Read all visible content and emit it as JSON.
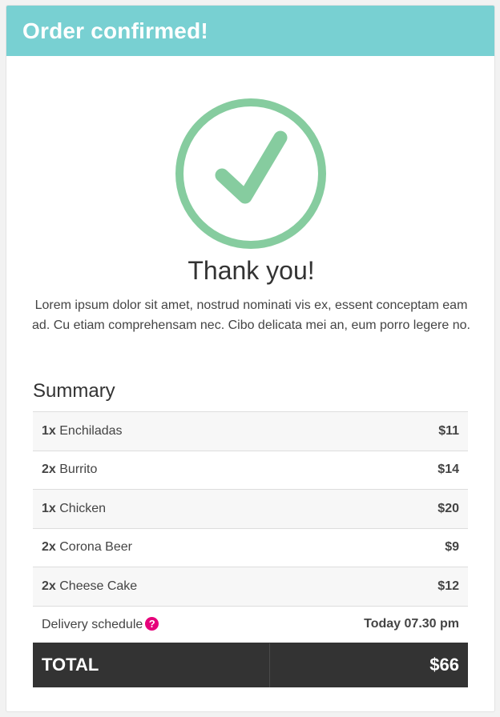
{
  "header": {
    "title": "Order confirmed!"
  },
  "confirmation": {
    "icon": "check-circle-icon",
    "icon_color": "#86cc9f",
    "heading": "Thank you!",
    "message": "Lorem ipsum dolor sit amet, nostrud nominati vis ex, essent conceptam eam ad. Cu etiam comprehensam nec. Cibo delicata mei an, eum porro legere no."
  },
  "summary": {
    "title": "Summary",
    "items": [
      {
        "qty": "1x",
        "name": "Enchiladas",
        "price": "$11"
      },
      {
        "qty": "2x",
        "name": "Burrito",
        "price": "$14"
      },
      {
        "qty": "1x",
        "name": "Chicken",
        "price": "$20"
      },
      {
        "qty": "2x",
        "name": "Corona Beer",
        "price": "$9"
      },
      {
        "qty": "2x",
        "name": "Cheese Cake",
        "price": "$12"
      }
    ],
    "delivery_label": "Delivery schedule",
    "delivery_help_icon": "question-circle-icon",
    "delivery_value": "Today 07.30 pm",
    "total_label": "TOTAL",
    "total_value": "$66"
  },
  "colors": {
    "header_bg": "#78d0d2",
    "accent_check": "#86cc9f",
    "help_icon": "#e6007a",
    "total_bg": "#333333"
  }
}
